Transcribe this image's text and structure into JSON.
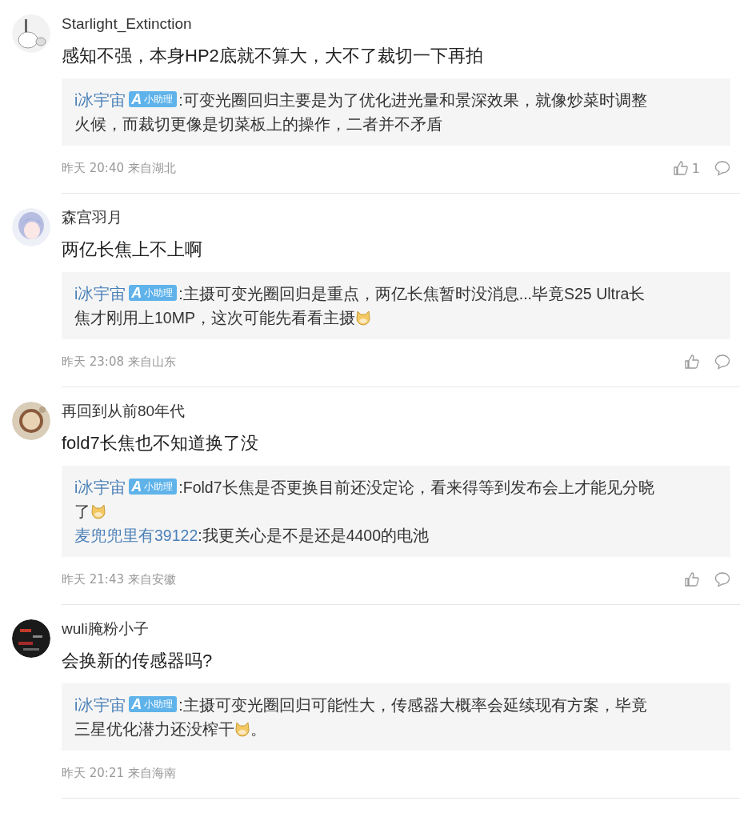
{
  "comments": [
    {
      "name": "Starlight_Extinction",
      "text": "感知不强，本身HP2底就不算大，大不了裁切一下再拍",
      "replies": [
        {
          "author": "i冰宇宙",
          "badge": {
            "mark": "A",
            "label": "小助理"
          },
          "lines": [
            [
              {
                "kind": "text",
                "text": ":可变光圈回归主要是为了优化进光量和景深效果，就像炒菜时调整"
              }
            ],
            [
              {
                "kind": "text",
                "text": "火候，而裁切更像是切菜板上的操作，二者并不矛盾"
              }
            ]
          ]
        }
      ],
      "time": "昨天 20:40 来自湖北",
      "actions_shown": true,
      "like_count": "1"
    },
    {
      "name": "森宫羽月",
      "text": "两亿长焦上不上啊",
      "replies": [
        {
          "author": "i冰宇宙",
          "badge": {
            "mark": "A",
            "label": "小助理"
          },
          "lines": [
            [
              {
                "kind": "text",
                "text": ":主摄可变光圈回归是重点，两亿长焦暂时没消息...毕竟S25 Ultra长"
              }
            ],
            [
              {
                "kind": "text",
                "text": "焦才刚用上10MP，这次可能先看看主摄"
              },
              {
                "kind": "emoji"
              }
            ]
          ]
        }
      ],
      "time": "昨天 23:08 来自山东",
      "actions_shown": true
    },
    {
      "name": "再回到从前80年代",
      "text": "fold7长焦也不知道换了没",
      "replies": [
        {
          "author": "i冰宇宙",
          "badge": {
            "mark": "A",
            "label": "小助理"
          },
          "lines": [
            [
              {
                "kind": "text",
                "text": ":Fold7长焦是否更换目前还没定论，看来得等到发布会上才能见分晓"
              }
            ],
            [
              {
                "kind": "text",
                "text": "了"
              },
              {
                "kind": "emoji"
              }
            ]
          ]
        },
        {
          "author": "麦兜兜里有39122",
          "lines": [
            [
              {
                "kind": "text",
                "text": ":我更关心是不是还是4400的电池"
              }
            ]
          ]
        }
      ],
      "time": "昨天 21:43 来自安徽",
      "actions_shown": true
    },
    {
      "name": "wuli腌粉小子",
      "text": "会换新的传感器吗?",
      "replies": [
        {
          "author": "i冰宇宙",
          "badge": {
            "mark": "A",
            "label": "小助理"
          },
          "lines": [
            [
              {
                "kind": "text",
                "text": ":主摄可变光圈回归可能性大，传感器大概率会延续现有方案，毕竟"
              }
            ],
            [
              {
                "kind": "text",
                "text": "三星优化潜力还没榨干"
              },
              {
                "kind": "emoji"
              },
              {
                "kind": "text",
                "text": "。"
              }
            ]
          ]
        }
      ],
      "time": "昨天 20:21 来自海南",
      "actions_shown": false
    }
  ]
}
